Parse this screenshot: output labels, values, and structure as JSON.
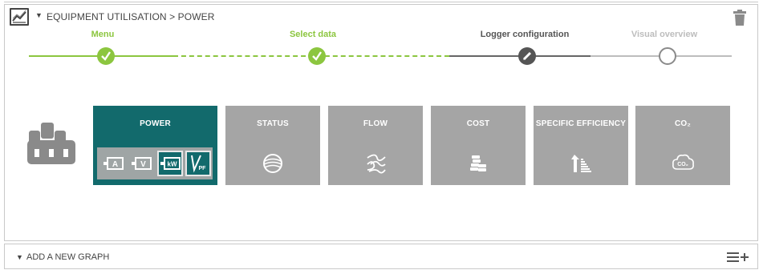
{
  "header": {
    "title": "EQUIPMENT UTILISATION > POWER",
    "icon": "line-chart-icon",
    "delete_icon": "trash-icon"
  },
  "wizard": {
    "steps": [
      {
        "label": "Menu",
        "state": "done",
        "color": "#8cc63f"
      },
      {
        "label": "Select data",
        "state": "done",
        "color": "#8cc63f"
      },
      {
        "label": "Logger configuration",
        "state": "current",
        "color": "#555555"
      },
      {
        "label": "Visual overview",
        "state": "pending",
        "color": "#bdbdbd"
      }
    ]
  },
  "equipment_icon": "factory-icon",
  "tiles": [
    {
      "label": "POWER",
      "active": true,
      "icon": "power-icon",
      "sub_options": [
        {
          "label": "A",
          "icon": "current-icon",
          "selected": false
        },
        {
          "label": "V",
          "icon": "voltage-icon",
          "selected": false
        },
        {
          "label": "kW",
          "icon": "kilowatt-icon",
          "selected": true
        },
        {
          "label": "PF",
          "icon": "power-factor-icon",
          "selected": false
        }
      ]
    },
    {
      "label": "STATUS",
      "active": false,
      "icon": "status-icon"
    },
    {
      "label": "FLOW",
      "active": false,
      "icon": "flow-icon"
    },
    {
      "label": "COST",
      "active": false,
      "icon": "cost-icon"
    },
    {
      "label": "SPECIFIC EFFICIENCY",
      "active": false,
      "icon": "efficiency-icon"
    },
    {
      "label": "CO₂",
      "active": false,
      "icon": "co2-icon"
    }
  ],
  "footer": {
    "label": "ADD A NEW GRAPH",
    "add_icon": "add-list-icon"
  },
  "colors": {
    "accent_green": "#8cc63f",
    "tile_active": "#126a6c",
    "tile_inactive": "#a5a5a5"
  }
}
